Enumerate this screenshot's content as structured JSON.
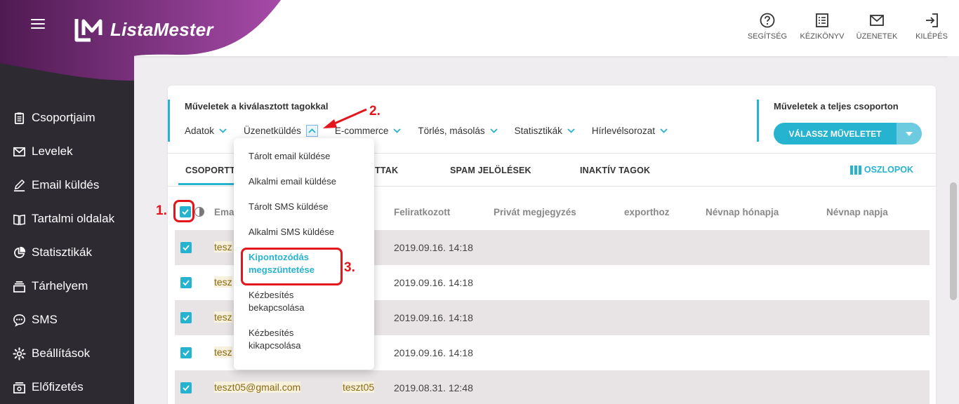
{
  "app": {
    "name": "ListaMester"
  },
  "colors": {
    "accent": "#26b3cf",
    "sidebar": "#2d2a31",
    "annotation": "#e4151b",
    "brand_gradient_start": "#5a1d5c",
    "brand_gradient_end": "#a243a4"
  },
  "sidebar": {
    "items": [
      {
        "label": "Csoportjaim",
        "icon": "clipboard-icon"
      },
      {
        "label": "Levelek",
        "icon": "mail-icon"
      },
      {
        "label": "Email küldés",
        "icon": "pen-icon"
      },
      {
        "label": "Tartalmi oldalak",
        "icon": "book-icon"
      },
      {
        "label": "Statisztikák",
        "icon": "pie-chart-icon"
      },
      {
        "label": "Tárhelyem",
        "icon": "storage-icon"
      },
      {
        "label": "SMS",
        "icon": "chat-bubble-icon"
      },
      {
        "label": "Beállítások",
        "icon": "gear-icon"
      },
      {
        "label": "Előfizetés",
        "icon": "subscription-icon"
      }
    ]
  },
  "topbar": {
    "actions": [
      {
        "label": "SEGÍTSÉG",
        "icon": "help-icon"
      },
      {
        "label": "KÉZIKÖNYV",
        "icon": "manual-icon"
      },
      {
        "label": "ÜZENETEK",
        "icon": "envelope-icon"
      },
      {
        "label": "KILÉPÉS",
        "icon": "logout-icon"
      }
    ]
  },
  "ops": {
    "selected_title": "Műveletek a kiválasztott tagokkal",
    "menu": [
      "Adatok",
      "Üzenetküldés",
      "E-commerce",
      "Törlés, másolás",
      "Statisztikák",
      "Hírlevélsorozat"
    ],
    "group_title": "Műveletek a teljes csoporton",
    "group_button": "VÁLASSZ MŰVELETET"
  },
  "tabs": {
    "items": [
      "CSOPORTT",
      "TTAK",
      "SPAM JELÖLÉSEK",
      "INAKTÍV TAGOK"
    ],
    "columns_label": "OSZLOPOK"
  },
  "table": {
    "headers": [
      "Ema",
      "Feliratkozott",
      "Privát megjegyzés",
      "exporthoz",
      "Névnap hónapja",
      "Névnap napja"
    ],
    "rows": [
      {
        "email": "tesz",
        "name": "",
        "date": "2019.09.16. 14:18"
      },
      {
        "email": "tesz",
        "name": "",
        "date": "2019.09.16. 14:18"
      },
      {
        "email": "tesz",
        "name": "",
        "date": "2019.09.16. 14:18"
      },
      {
        "email": "tesz",
        "name": "",
        "date": "2019.09.16. 14:18"
      },
      {
        "email": "teszt05@gmail.com",
        "name": "teszt05",
        "date": "2019.08.31. 12:48"
      }
    ]
  },
  "dropdown": {
    "items": [
      "Tárolt email küldése",
      "Alkalmi email küldése",
      "Tárolt SMS küldése",
      "Alkalmi SMS küldése",
      "Kipontozódás megszüntetése",
      "Kézbesítés bekapcsolása",
      "Kézbesítés kikapcsolása"
    ]
  },
  "annotations": {
    "step1": "1.",
    "step2": "2.",
    "step3": "3."
  }
}
